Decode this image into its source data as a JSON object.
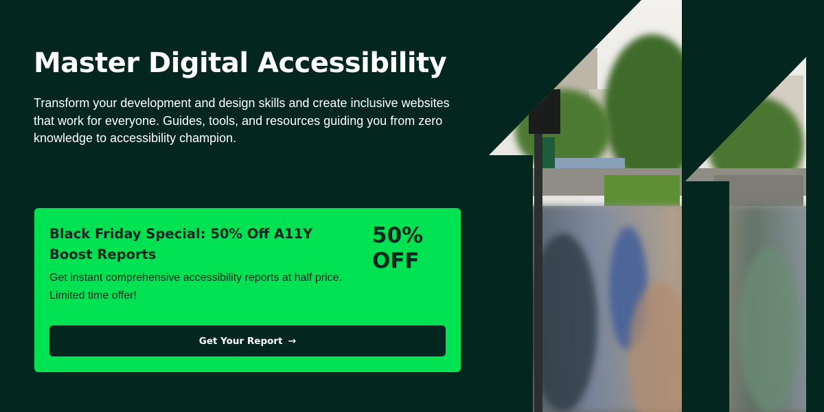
{
  "hero": {
    "title": "Master Digital Accessibility",
    "description": "Transform your development and design skills and create inclusive websites that work for everyone. Guides, tools, and resources guiding you from zero knowledge to accessibility champion."
  },
  "promo": {
    "title": "Black Friday Special: 50% Off A11Y Boost Reports",
    "description": "Get instant comprehensive accessibility reports at half price. Limited time offer!",
    "discount": "50%\nOFF",
    "cta_label": "Get Your Report",
    "cta_icon": "arrow-right-icon"
  },
  "graphic": {
    "subject": "photo of pedestrians crossing a tree-lined city street, cropped into a stylized '11' shape",
    "colors": {
      "background": "#03261f",
      "accent": "#00e251",
      "text_light": "#ffffff",
      "text_dark": "#04271f"
    }
  }
}
